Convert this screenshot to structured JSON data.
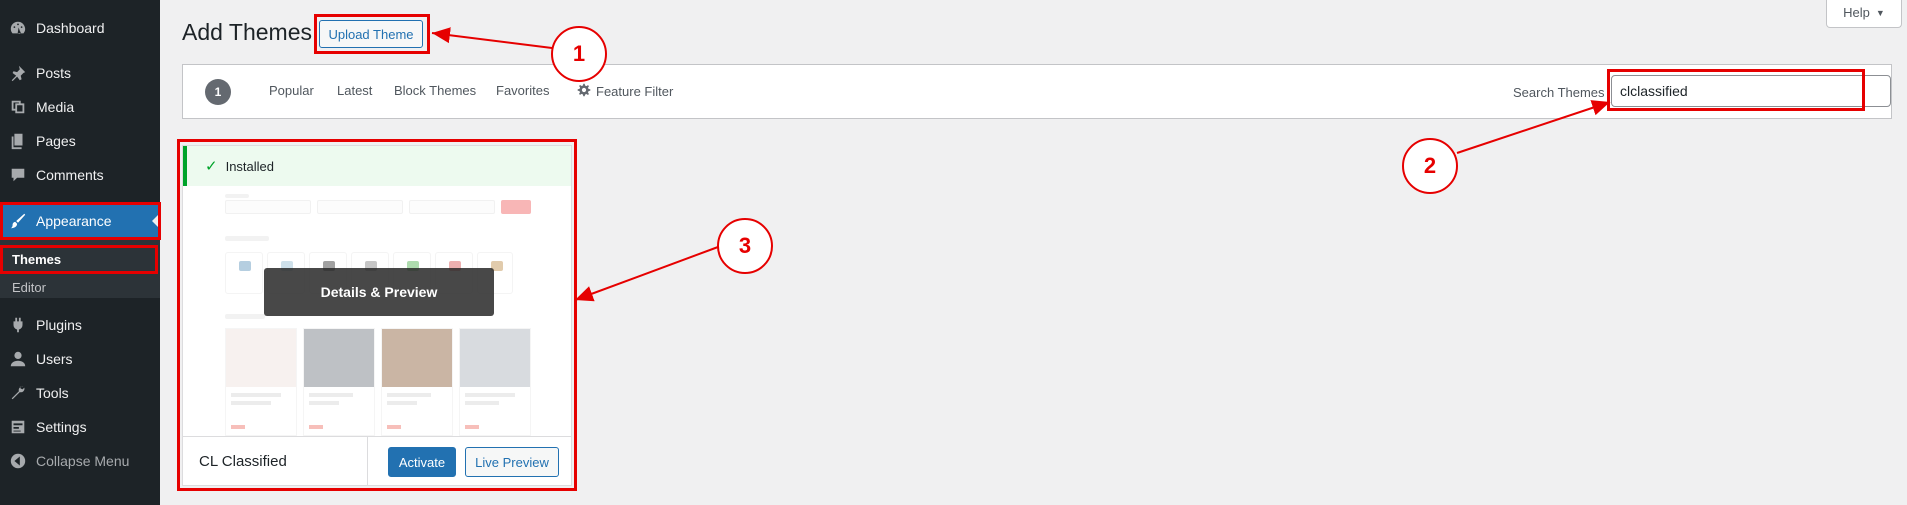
{
  "sidebar": {
    "items": [
      {
        "label": "Dashboard",
        "icon": "dashboard-icon"
      },
      {
        "label": "Posts",
        "icon": "pin-icon"
      },
      {
        "label": "Media",
        "icon": "media-icon"
      },
      {
        "label": "Pages",
        "icon": "pages-icon"
      },
      {
        "label": "Comments",
        "icon": "comment-icon"
      },
      {
        "label": "Appearance",
        "icon": "paintbrush-icon",
        "active": true
      },
      {
        "label": "Plugins",
        "icon": "plugin-icon"
      },
      {
        "label": "Users",
        "icon": "users-icon"
      },
      {
        "label": "Tools",
        "icon": "wrench-icon"
      },
      {
        "label": "Settings",
        "icon": "settings-icon"
      },
      {
        "label": "Collapse Menu",
        "icon": "collapse-icon"
      }
    ],
    "submenu": [
      {
        "label": "Themes",
        "current": true
      },
      {
        "label": "Editor"
      }
    ]
  },
  "header": {
    "title": "Add Themes",
    "upload_label": "Upload Theme",
    "help_label": "Help"
  },
  "filters": {
    "count": "1",
    "tabs": [
      "Popular",
      "Latest",
      "Block Themes",
      "Favorites"
    ],
    "feature_filter": "Feature Filter",
    "search_label": "Search Themes",
    "search_value": "clclassified"
  },
  "theme": {
    "installed_label": "Installed",
    "overlay_label": "Details & Preview",
    "name": "CL Classified",
    "activate_label": "Activate",
    "live_preview_label": "Live Preview"
  },
  "annotations": {
    "step1": "1",
    "step2": "2",
    "step3": "3"
  },
  "colors": {
    "sidebar_bg": "#1d2327",
    "accent": "#2271b1",
    "annotation_red": "#e60000",
    "installed_green": "#00a32a"
  }
}
